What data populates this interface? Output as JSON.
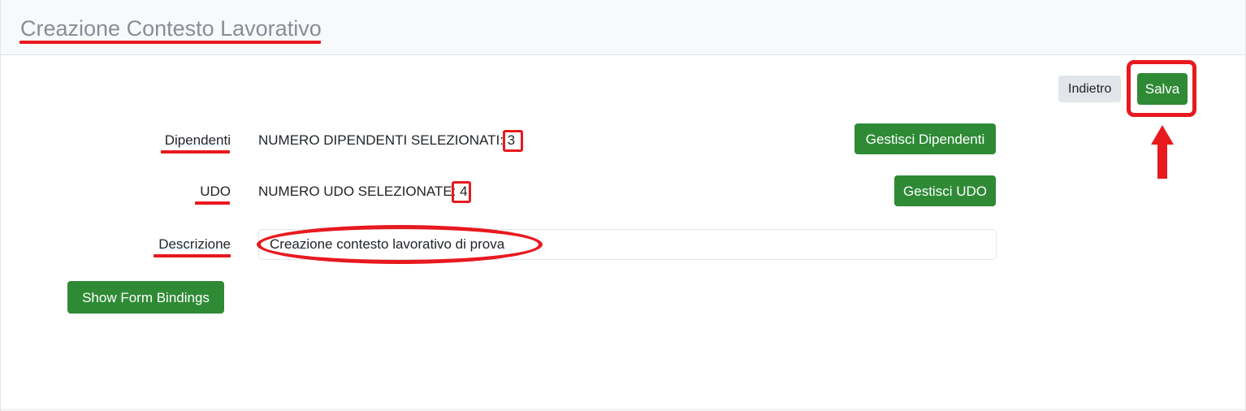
{
  "page": {
    "title": "Creazione Contesto Lavorativo"
  },
  "toolbar": {
    "back_label": "Indietro",
    "save_label": "Salva"
  },
  "form": {
    "rows": [
      {
        "label": "Dipendenti",
        "static_text": "NUMERO DIPENDENTI SELEZIONATI: 3",
        "value": "3",
        "action_label": "Gestisci Dipendenti"
      },
      {
        "label": "UDO",
        "static_text": "NUMERO UDO SELEZIONATE: 4",
        "value": "4",
        "action_label": "Gestisci UDO"
      },
      {
        "label": "Descrizione",
        "input_value": "Creazione contesto lavorativo di prova",
        "input_placeholder": ""
      }
    ],
    "show_bindings_label": "Show Form Bindings"
  },
  "annotations": {
    "color": "#e8191f",
    "items": [
      {
        "type": "underline",
        "target": "page-title"
      },
      {
        "type": "underline",
        "target": "label-dipendenti"
      },
      {
        "type": "underline",
        "target": "label-udo"
      },
      {
        "type": "underline",
        "target": "label-descrizione"
      },
      {
        "type": "box",
        "target": "numero-dipendenti-value"
      },
      {
        "type": "box",
        "target": "numero-udo-value"
      },
      {
        "type": "box",
        "target": "save-button"
      },
      {
        "type": "ellipse",
        "target": "descrizione-input"
      },
      {
        "type": "arrow-up",
        "target": "save-button"
      }
    ]
  },
  "colors": {
    "green": "#2f8a36",
    "secondary": "#e2e6ea",
    "header_bg": "#f8f9fa",
    "title_text": "#868e96",
    "annotation_red": "#e8191f"
  }
}
